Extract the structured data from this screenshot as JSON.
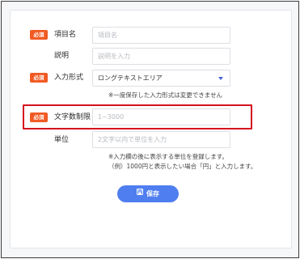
{
  "form": {
    "required_badge": "必須",
    "item_name": {
      "label": "項目名",
      "placeholder": "項目名"
    },
    "description": {
      "label": "説明",
      "placeholder": "説明を入力"
    },
    "input_type": {
      "label": "入力形式",
      "value": "ロングテキストエリア",
      "note": "※一度保存した入力形式は変更できません"
    },
    "char_limit": {
      "label": "文字数制限",
      "placeholder": "1~3000"
    },
    "unit": {
      "label": "単位",
      "placeholder": "2文字以内で単位を入力",
      "note_line1": "※入力欄の後に表示する単位を登録します。",
      "note_line2": "（例）1000円と表示したい場合「円」と入力します。"
    },
    "save_label": "保存"
  },
  "colors": {
    "badge": "#f15a23",
    "primary": "#4f7ef0",
    "highlight": "#d6121f"
  }
}
